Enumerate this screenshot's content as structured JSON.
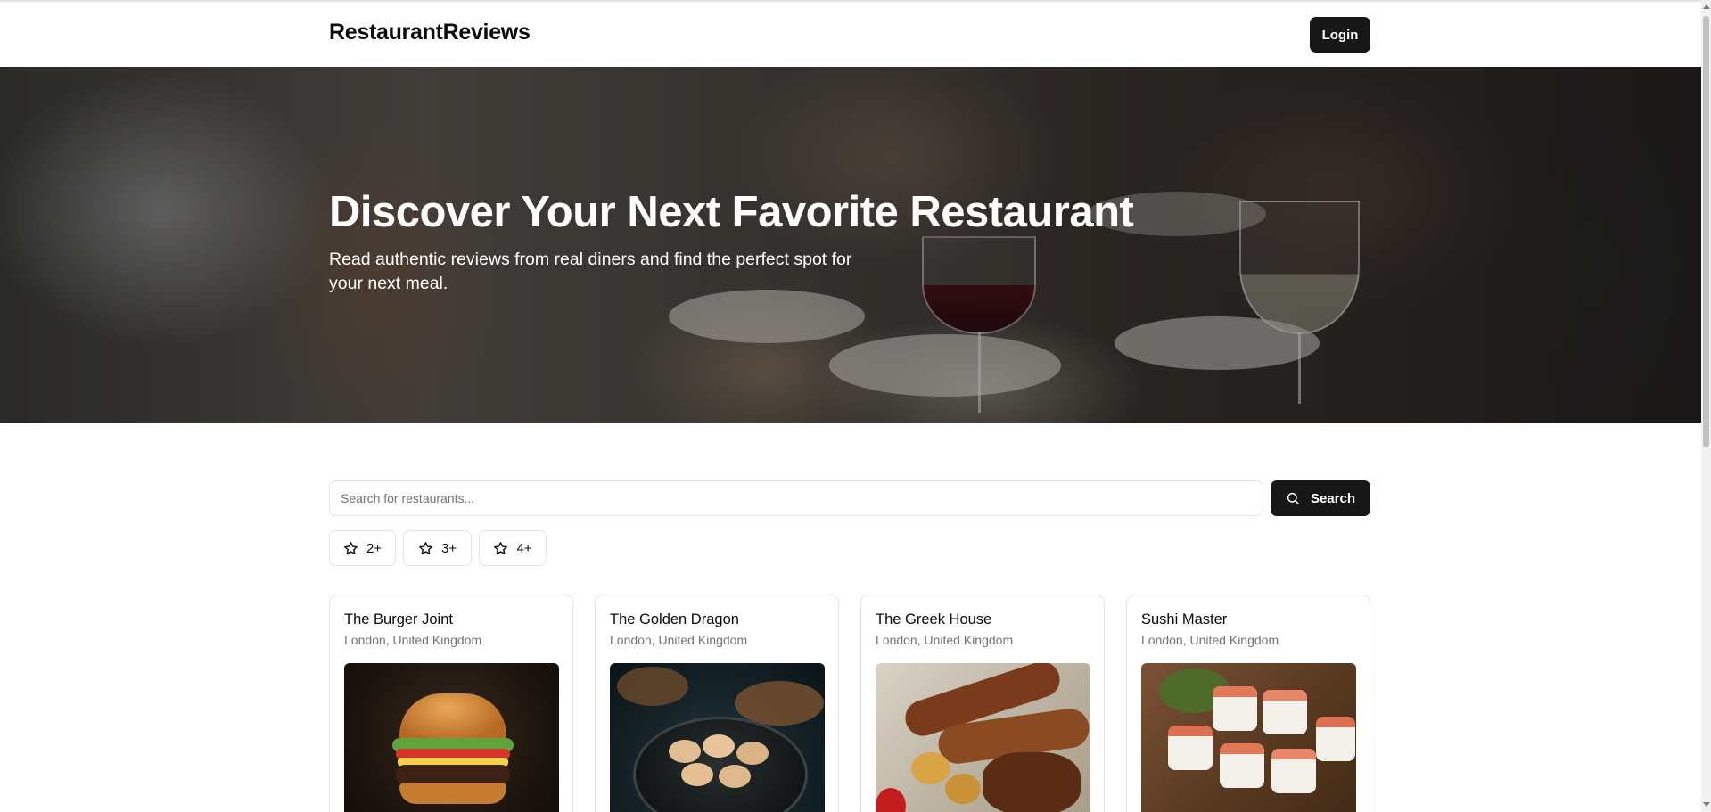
{
  "header": {
    "brand": "RestaurantReviews",
    "login_label": "Login"
  },
  "hero": {
    "title": "Discover Your Next Favorite Restaurant",
    "subtitle": "Read authentic reviews from real diners and find the perfect spot for your next meal."
  },
  "search": {
    "placeholder": "Search for restaurants...",
    "value": "",
    "button_label": "Search"
  },
  "filters": [
    {
      "label": "2+",
      "icon": "star-icon"
    },
    {
      "label": "3+",
      "icon": "star-icon"
    },
    {
      "label": "4+",
      "icon": "star-icon"
    }
  ],
  "restaurants": [
    {
      "name": "The Burger Joint",
      "location": "London, United Kingdom",
      "image": "burger"
    },
    {
      "name": "The Golden Dragon",
      "location": "London, United Kingdom",
      "image": "dumplings"
    },
    {
      "name": "The Greek House",
      "location": "London, United Kingdom",
      "image": "grilled-meat"
    },
    {
      "name": "Sushi Master",
      "location": "London, United Kingdom",
      "image": "sushi"
    }
  ],
  "colors": {
    "primary": "#171717",
    "border": "#e4e4e7",
    "muted_text": "#71717a"
  }
}
